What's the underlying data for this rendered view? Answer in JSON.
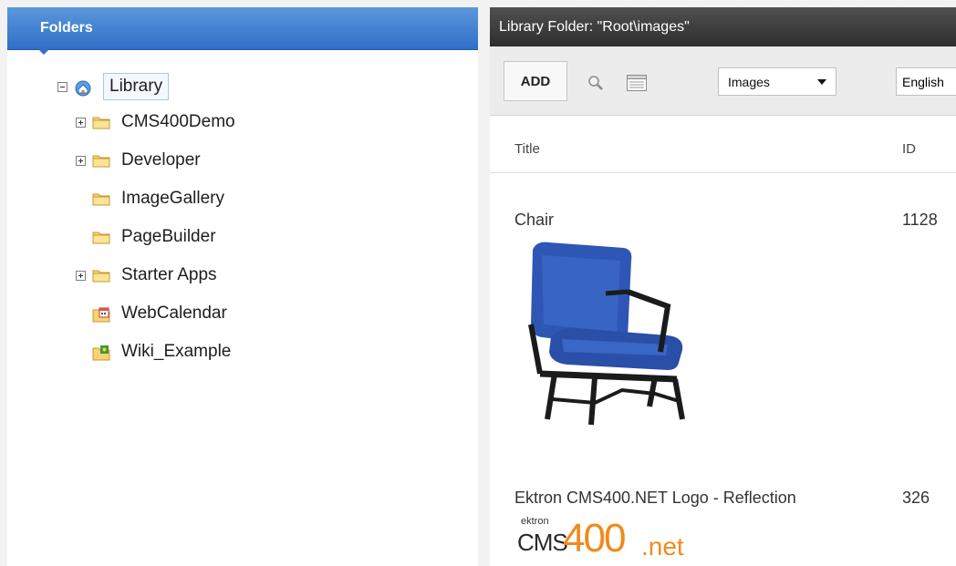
{
  "left_panel": {
    "header": "Folders",
    "tree": [
      {
        "label": "Library",
        "expander": "minus",
        "icon": "home-library-icon",
        "level": 0
      },
      {
        "label": "CMS400Demo",
        "expander": "plus",
        "icon": "folder-icon",
        "level": 1
      },
      {
        "label": "Developer",
        "expander": "plus",
        "icon": "folder-icon",
        "level": 1
      },
      {
        "label": "ImageGallery",
        "expander": "",
        "icon": "folder-icon",
        "level": 1
      },
      {
        "label": "PageBuilder",
        "expander": "",
        "icon": "folder-icon",
        "level": 1
      },
      {
        "label": "Starter Apps",
        "expander": "plus",
        "icon": "folder-icon",
        "level": 1
      },
      {
        "label": "WebCalendar",
        "expander": "",
        "icon": "calendar-folder-icon",
        "level": 1
      },
      {
        "label": "Wiki_Example",
        "expander": "",
        "icon": "wiki-folder-icon",
        "level": 1
      }
    ]
  },
  "right_panel": {
    "header": "Library Folder: \"Root\\images\"",
    "toolbar": {
      "add_label": "ADD",
      "type_select": "Images",
      "language_select": "English"
    },
    "columns": {
      "title": "Title",
      "id": "ID"
    },
    "rows": [
      {
        "title": "Chair",
        "id": "1128",
        "thumb": "blue-chair-image"
      },
      {
        "title": "Ektron CMS400.NET Logo - Reflection",
        "id": "326",
        "thumb": "cms400-logo-image",
        "logo_small": "ektron",
        "logo_cms": "CMS",
        "logo_num": "400",
        "logo_suffix": ".net"
      }
    ]
  },
  "colors": {
    "left_header": "#2f6fc6",
    "right_header": "#3a3a3a",
    "logo_orange": "#f08a1c",
    "chair_blue": "#2e56b5"
  }
}
